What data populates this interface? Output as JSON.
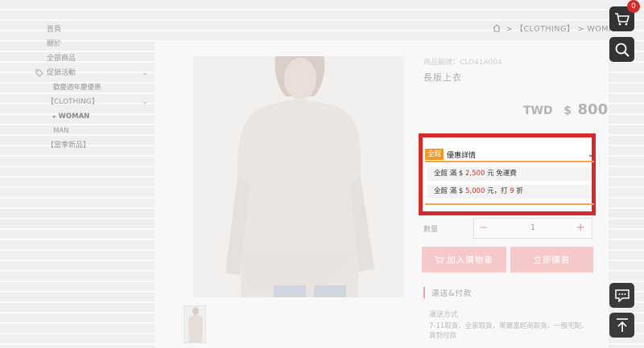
{
  "menu": {
    "items": [
      {
        "label": "首頁"
      },
      {
        "label": "關於"
      },
      {
        "label": "全部商品"
      },
      {
        "label": "促銷活動"
      },
      {
        "label": "歡慶週年慶優惠"
      },
      {
        "label": "【CLOTHING】"
      },
      {
        "label": "WOMAN"
      },
      {
        "label": "MAN"
      },
      {
        "label": "【當季新品】"
      }
    ]
  },
  "breadcrumb": {
    "sep": ">",
    "items": [
      "【CLOTHING】",
      "WOMAN"
    ]
  },
  "product": {
    "sku": "商品編號：CLO41A004",
    "name": "長版上衣",
    "currency": "TWD",
    "symbol": "$",
    "price": "800"
  },
  "promo": {
    "badge": "全館",
    "title": "優惠詳情",
    "rules": [
      {
        "prefix": "全館 滿 $",
        "amount": "2,500",
        "suffix": "元 免運費"
      },
      {
        "prefix": "全館 滿 $",
        "amount": "5,000",
        "mid": "元，打",
        "discount": "9",
        "suffix": "折"
      }
    ]
  },
  "quantity": {
    "label": "數量",
    "value": "1",
    "minus": "−",
    "plus": "+"
  },
  "buttons": {
    "add_to_cart": "加入購物車",
    "buy_now": "立即購買"
  },
  "shipping": {
    "title": "運送&付款",
    "subtitle": "運送方式",
    "desc": "7-11取貨、全家取貨、萊爾富超商取貨、一般宅配、貨到付款"
  },
  "cart": {
    "count": "0"
  },
  "icons": [
    "tag-icon",
    "home-icon",
    "cart-icon",
    "search-icon",
    "chat-icon",
    "back-to-top-icon",
    "chevron-down-icon"
  ],
  "colors": {
    "accent": "#d42a2a",
    "badge": "#f39a22",
    "button_bg": "#f5c9c9",
    "fab_bg": "#333333"
  }
}
